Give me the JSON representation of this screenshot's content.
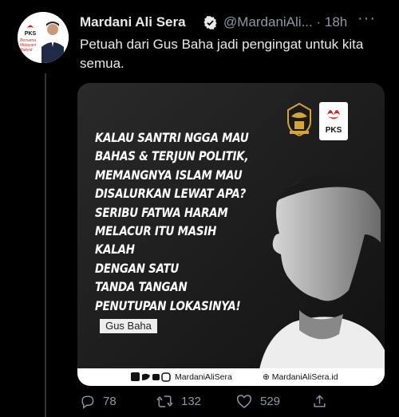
{
  "tweet": {
    "author_name": "Mardani Ali Sera",
    "handle": "@MardaniAli...",
    "time": "· 18h",
    "more": "···",
    "text": "Petuah dari Gus Baha jadi pengingat untuk kita semua."
  },
  "avatar": {
    "logo_text": "PKS",
    "caption_lines": [
      "Bersama",
      "Melayani",
      "Rakyat"
    ]
  },
  "card": {
    "quote": "KALAU SANTRI NGGA MAU\nBAHAS & TERJUN POLITIK,\nMEMANGNYA ISLAM MAU\nDISALURKAN LEWAT APA?\nSERIBU FATWA HARAM\nMELACUR ITU MASIH KALAH\nDENGAN SATU\nTANDA TANGAN\nPENUTUPAN LOKASINYA!",
    "author": "Gus Baha",
    "pks_logo_text": "PKS",
    "footer_handle": "MardaniAliSera",
    "footer_site": "MardaniAliSera.id"
  },
  "actions": {
    "replies": "78",
    "retweets": "132",
    "likes": "529"
  },
  "colors": {
    "background": "#000000",
    "text": "#e7e9ea",
    "muted": "#8b98a5",
    "pks_red": "#e2231a"
  }
}
